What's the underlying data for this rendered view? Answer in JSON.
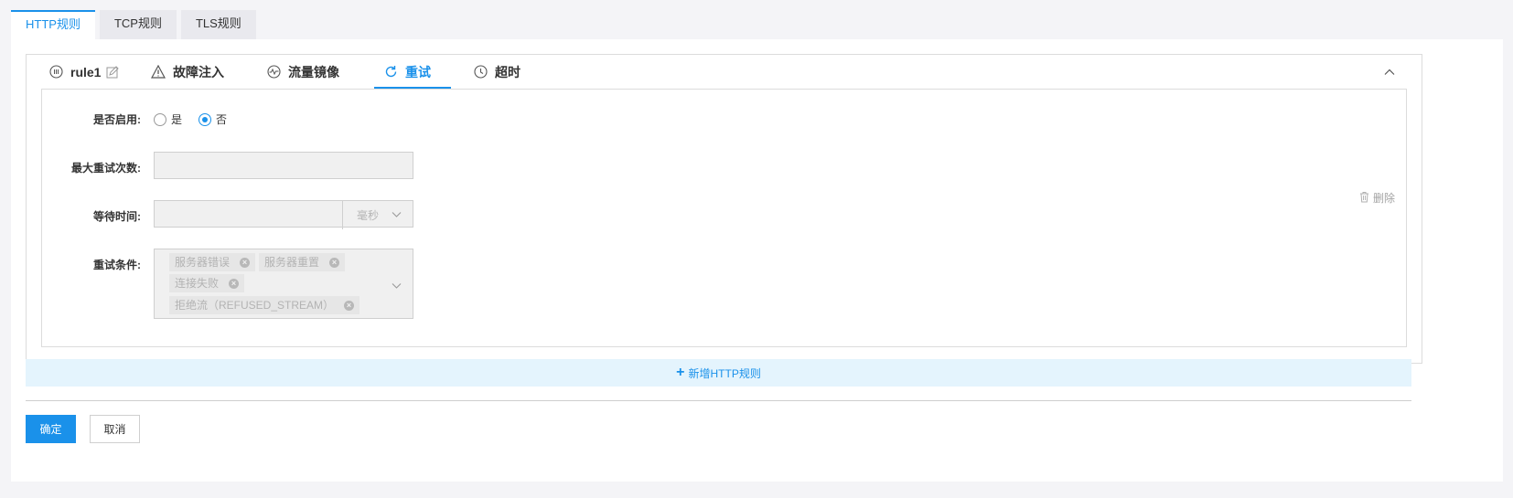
{
  "top_tabs": [
    {
      "label": "HTTP规则",
      "active": true
    },
    {
      "label": "TCP规则",
      "active": false
    },
    {
      "label": "TLS规则",
      "active": false
    }
  ],
  "rule_tabs": {
    "rule_name": "rule1",
    "fault": "故障注入",
    "mirror": "流量镜像",
    "retry": "重试",
    "timeout": "超时",
    "active": "retry"
  },
  "form": {
    "enable_label": "是否启用:",
    "enable_options": [
      "是",
      "否"
    ],
    "enable_selected": "否",
    "max_retries_label": "最大重试次数:",
    "max_retries_value": "",
    "wait_time_label": "等待时间:",
    "wait_time_value": "",
    "wait_time_unit": "毫秒",
    "retry_conditions_label": "重试条件:",
    "retry_conditions": [
      "服务器错误",
      "服务器重置",
      "连接失败",
      "拒绝流（REFUSED_STREAM）"
    ]
  },
  "delete_label": "删除",
  "add_rule_label": "新增HTTP规则",
  "confirm_label": "确定",
  "cancel_label": "取消",
  "colors": {
    "accent": "#1a91ea",
    "add_rule_bg": "#e4f4fd",
    "disabled_bg": "#f0f0f0"
  }
}
